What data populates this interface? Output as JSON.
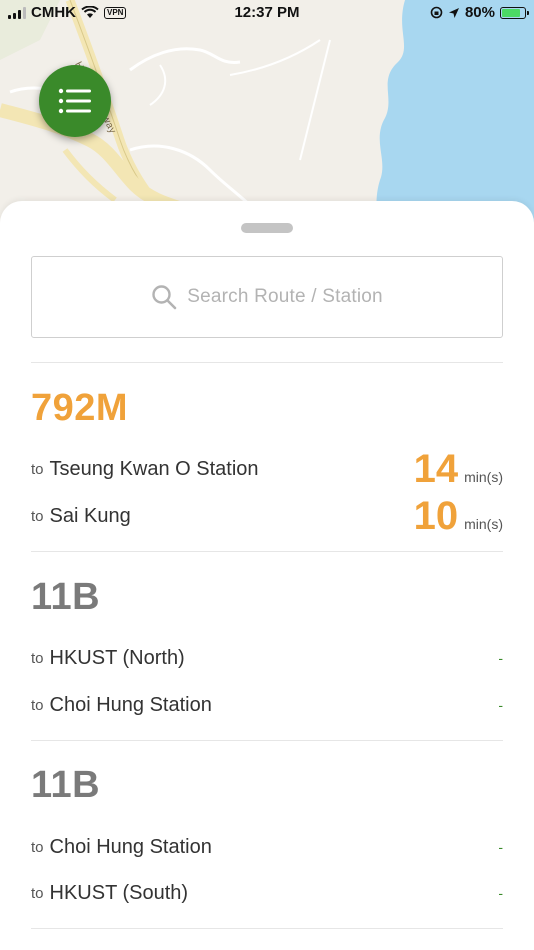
{
  "status_bar": {
    "carrier": "CMHK",
    "vpn": "VPN",
    "time": "12:37 PM",
    "battery_percent": "80%",
    "battery_level": 0.8
  },
  "map": {
    "road_label": "Hiram's Highway"
  },
  "menu_button": {
    "icon": "list-icon",
    "color": "#3a8a2a"
  },
  "search": {
    "placeholder": "Search Route / Station",
    "icon": "search-icon"
  },
  "colors": {
    "active_route": "#f0a23a",
    "inactive_route": "#7a7a7a",
    "no_eta": "#3a8a2a"
  },
  "routes": [
    {
      "number": "792M",
      "destinations": [
        {
          "to": "to",
          "name": "Tseung Kwan O Station",
          "eta": "14",
          "unit": "min(s)"
        },
        {
          "to": "to",
          "name": "Sai Kung",
          "eta": "10",
          "unit": "min(s)"
        }
      ]
    },
    {
      "number": "11B",
      "destinations": [
        {
          "to": "to",
          "name": "HKUST (North)",
          "eta": "-"
        },
        {
          "to": "to",
          "name": "Choi Hung Station",
          "eta": "-"
        }
      ]
    },
    {
      "number": "11B",
      "destinations": [
        {
          "to": "to",
          "name": "Choi Hung Station",
          "eta": "-"
        },
        {
          "to": "to",
          "name": "HKUST (South)",
          "eta": "-"
        }
      ]
    }
  ]
}
